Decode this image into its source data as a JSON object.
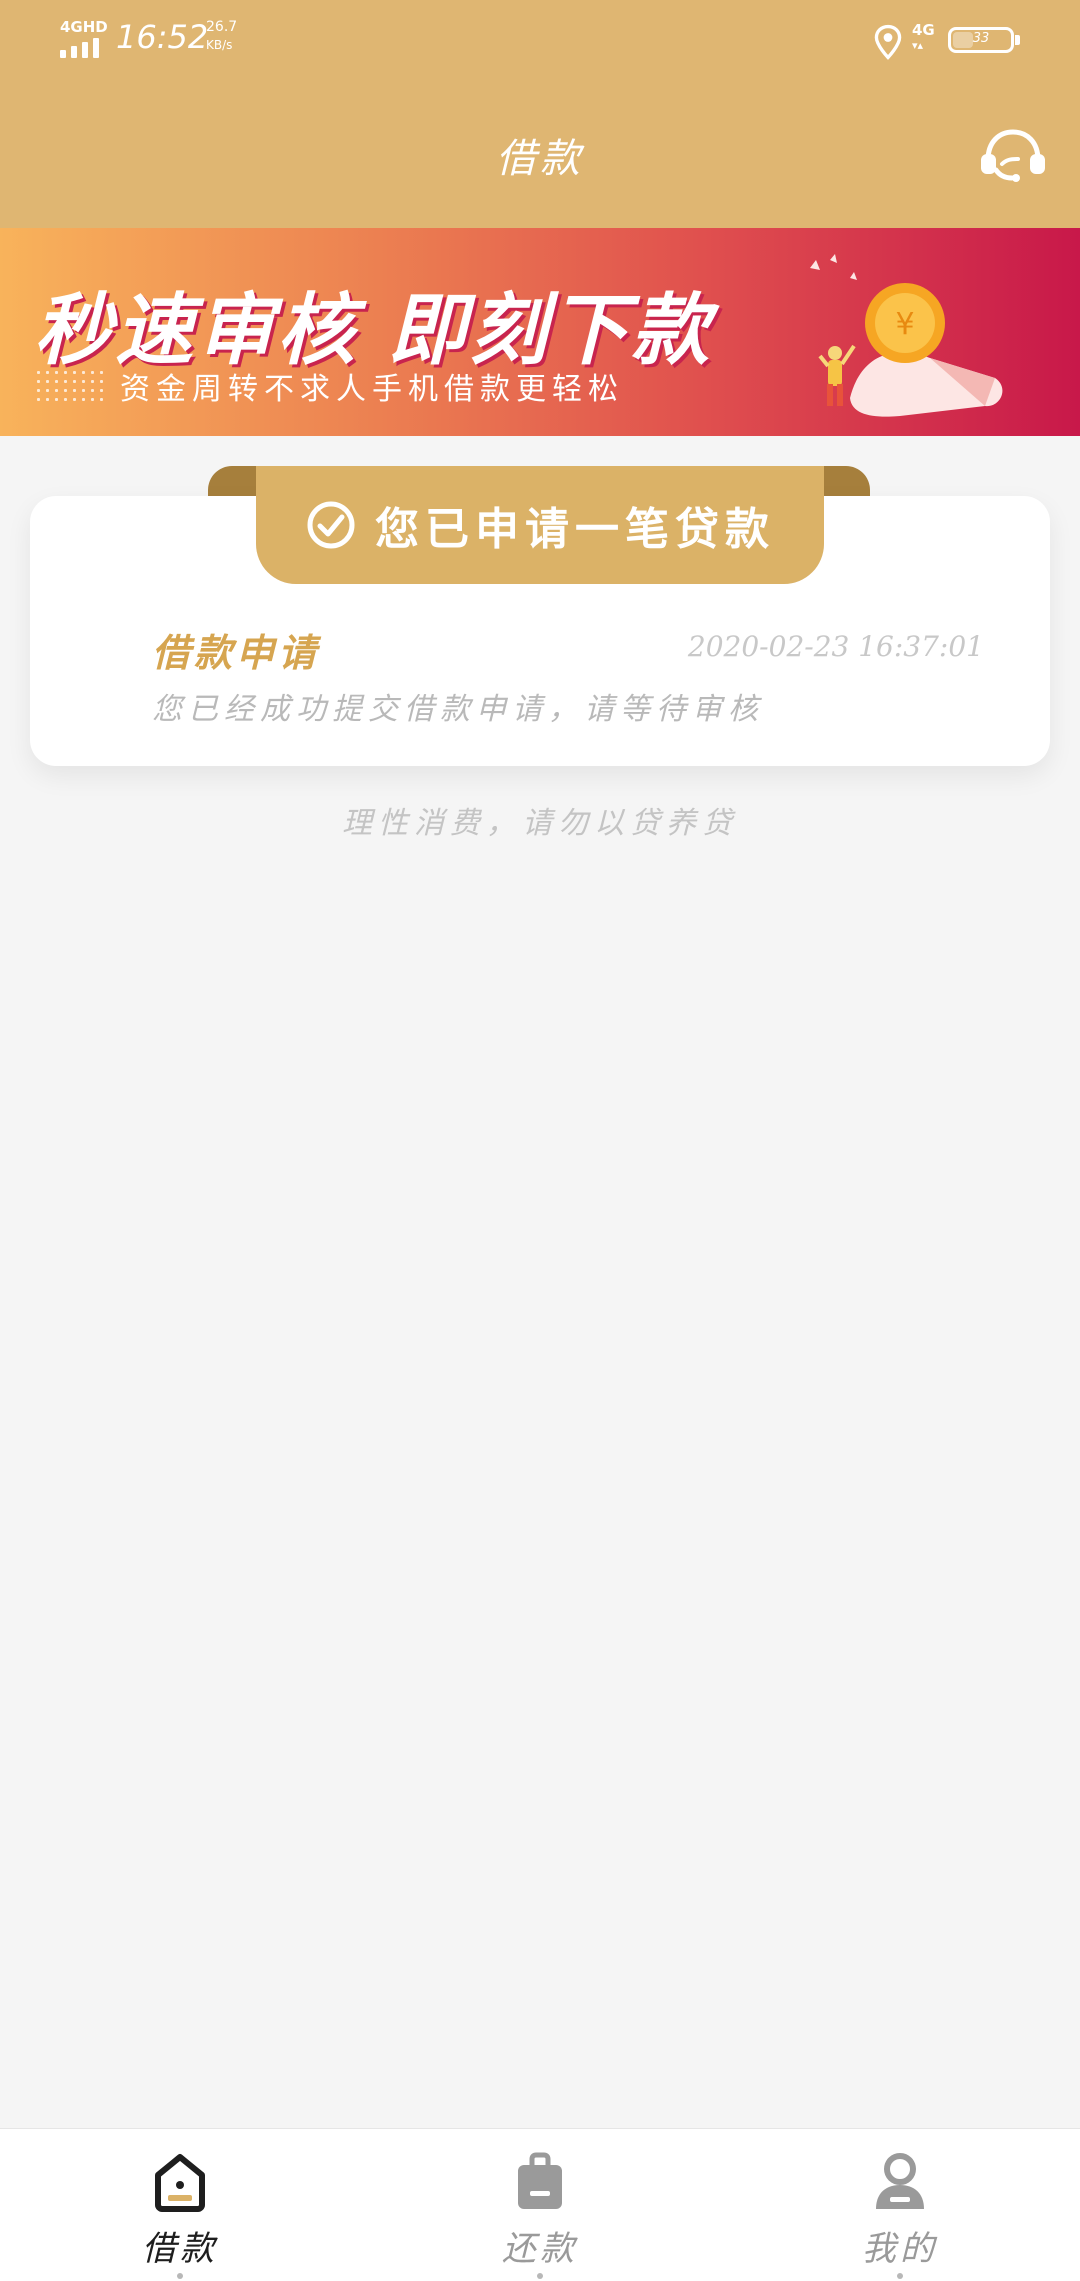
{
  "status_bar": {
    "network_tag": "4GHD",
    "time": "16:52",
    "speed_value": "26.7",
    "speed_unit": "KB/s",
    "net_type": "4G",
    "battery": "33"
  },
  "header": {
    "title": "借款",
    "support_icon": "headset-icon"
  },
  "banner": {
    "headline": "秒速审核 即刻下款",
    "subline": "资金周转不求人手机借款更轻松"
  },
  "status_card": {
    "ribbon_text": "您已申请一笔贷款",
    "title": "借款申请",
    "timestamp": "2020-02-23 16:37:01",
    "description": "您已经成功提交借款申请，请等待审核"
  },
  "notice": "理性消费，请勿以贷养贷",
  "tabs": [
    {
      "label": "借款",
      "icon": "home-icon",
      "active": true
    },
    {
      "label": "还款",
      "icon": "bag-icon",
      "active": false
    },
    {
      "label": "我的",
      "icon": "user-icon",
      "active": false
    }
  ],
  "colors": {
    "brand_gold": "#dfb672",
    "ribbon": "#dbb267",
    "title_gold": "#d6a550"
  }
}
